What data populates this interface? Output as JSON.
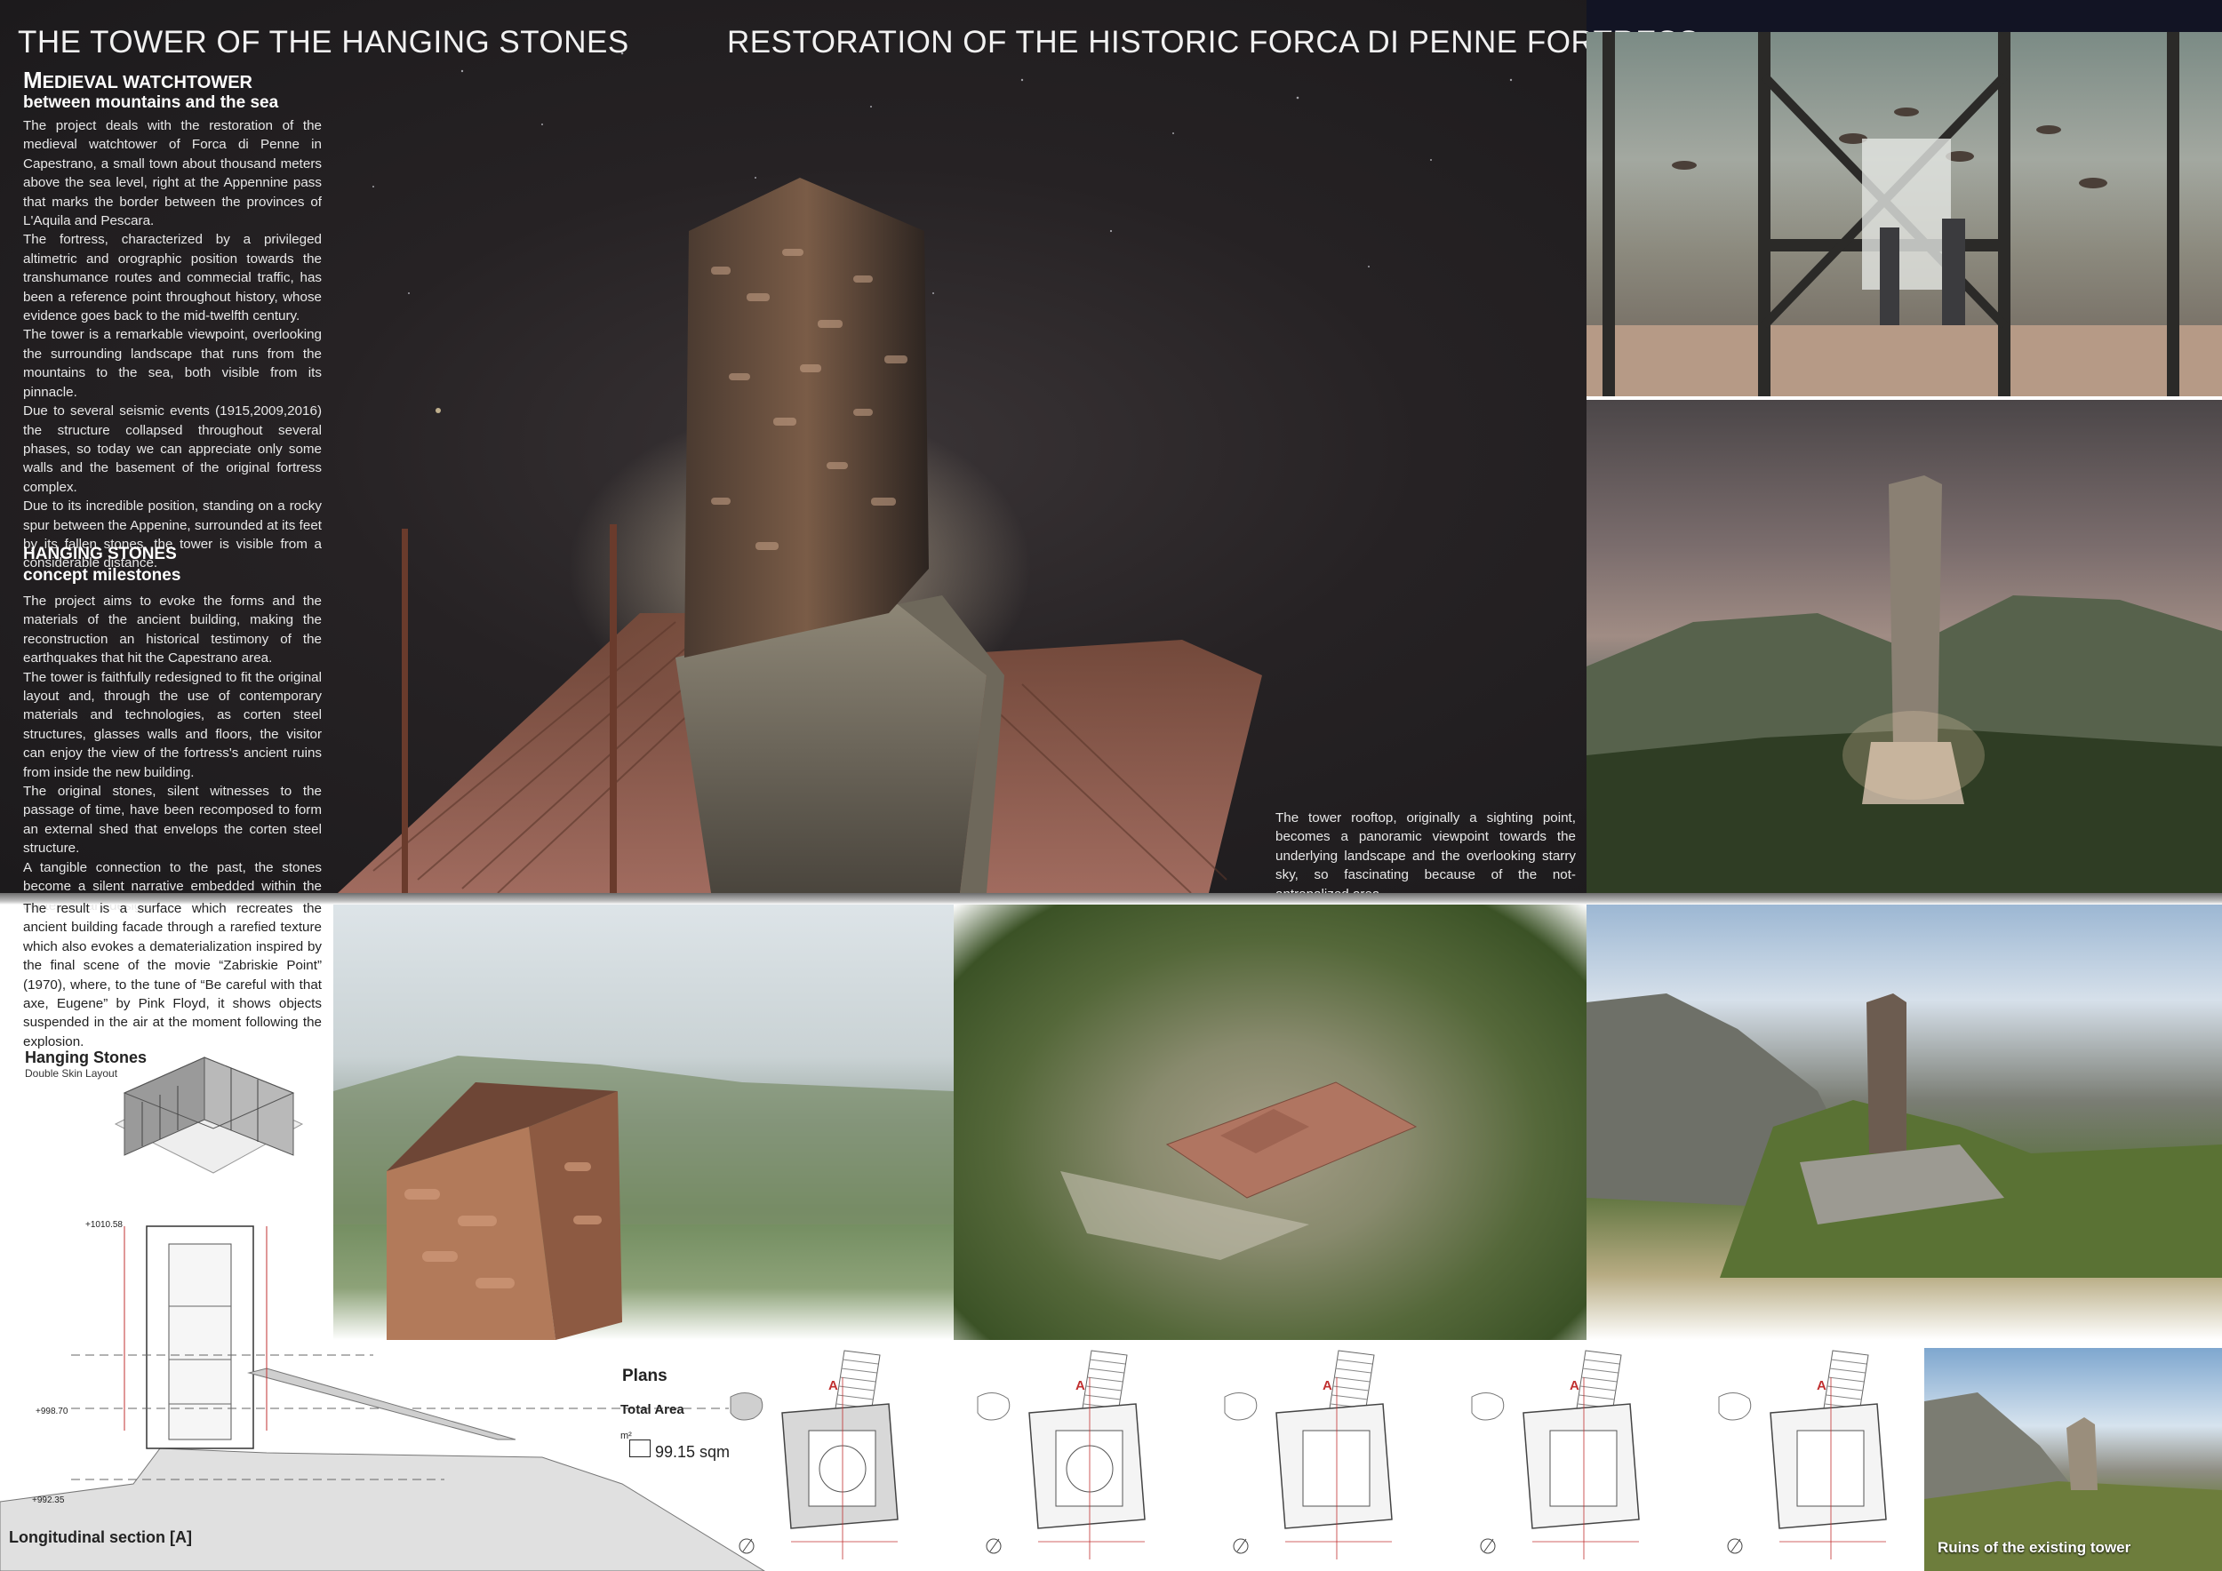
{
  "titles": {
    "main": "THE TOWER  OF THE HANGING STONES",
    "sub": "RESTORATION  OF THE HISTORIC FORCA DI PENNE FORTRESS"
  },
  "intro": {
    "heading_line1_big": "M",
    "heading_line1_rest": "EDIEVAL WATCHTOWER",
    "heading_line2": "between mountains and the sea",
    "paragraphs": [
      "The project deals with the restoration of the medieval watchtower of Forca di Penne in Capestrano, a small town about thousand meters above the sea level, right at the Appennine pass that marks the border between the provinces of L'Aquila and Pescara.",
      "The fortress, characterized by a privileged altimetric and orographic position towards the transhumance routes and commecial traffic, has been a reference point throughout history, whose evidence goes back to the mid-twelfth century.",
      "The tower is a remarkable viewpoint, overlooking the surrounding landscape that runs from the mountains to the sea, both visible from its pinnacle.",
      "Due to several seismic events (1915,2009,2016) the structure collapsed throughout several phases, so today we can appreciate only some walls and the basement of the original fortress complex.",
      "Due to its incredible position, standing on a rocky spur between the Appenine, surrounded at its feet by its fallen stones, the tower is visible from a considerable distance."
    ]
  },
  "concept": {
    "heading_line1": "HANGING STONES",
    "heading_line2": "concept milestones",
    "paragraphs": [
      "The project aims to evoke the forms and the materials of the ancient building, making the reconstruction an historical testimony of the earthquakes that hit the Capestrano area.",
      "The tower is faithfully redesigned to fit the original layout and, through the use of contemporary materials and technologies, as corten steel structures, glasses walls and floors, the visitor can enjoy the view of the fortress's ancient ruins from inside the new building.",
      "The original stones, silent witnesses to the passage of time, have been recomposed to form an external shed that envelops the corten steel structure.",
      "A tangible connection to the past, the stones become a silent narrative embedded within the contemporary design."
    ],
    "continuation": "The result is a surface which recreates the ancient building facade through a rarefied texture which also evokes  a dematerialization inspired by the final scene of the movie “Zabriskie Point” (1970), where, to the tune of “Be careful with that axe, Eugene” by Pink Floyd, it shows objects suspended in the air at the moment following the explosion."
  },
  "rooftop_caption": "The tower rooftop, originally a sighting point, becomes a panoramic viewpoint towards the underlying landscape and the overlooking starry sky, so fascinating because of the not-antropalized area.",
  "hanging_stones_diagram": {
    "title": "Hanging Stones",
    "subtitle": "Double Skin Layout"
  },
  "section": {
    "label": "Longitudinal section [A]",
    "elevations": [
      "+1010.58",
      "+998.70",
      "+992.35"
    ]
  },
  "plans": {
    "title": "Plans",
    "area_label": "Total Area",
    "area_unit": "m²",
    "area_value": "99.15 sqm",
    "section_marker": "A",
    "count": 5
  },
  "ruins_caption": "Ruins of the existing tower",
  "icons": {
    "north_arrow": "north-arrow-icon"
  }
}
